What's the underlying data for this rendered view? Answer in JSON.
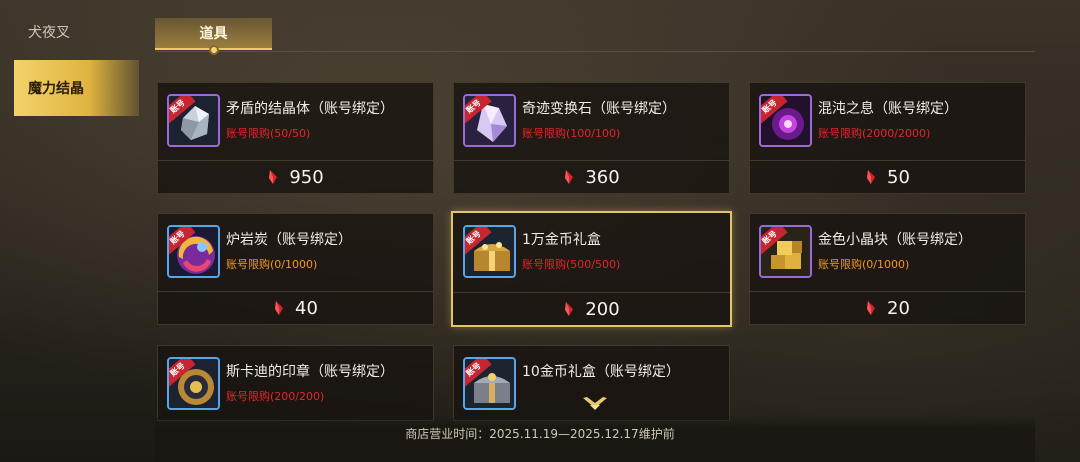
{
  "sidebar": {
    "items": [
      {
        "label": "犬夜叉",
        "selected": false
      },
      {
        "label": "魔力结晶",
        "selected": true
      }
    ]
  },
  "tabs": [
    {
      "label": "道具",
      "selected": true
    }
  ],
  "badge_text": "账号",
  "colors": {
    "accent_gold": "#e2c46a",
    "limit_red": "#e4252c",
    "limit_orange": "#f09a1e",
    "currency_red": "#d8232e"
  },
  "items": [
    {
      "name": "矛盾的结晶体（账号绑定）",
      "limit": "账号限购(50/50)",
      "price": "950",
      "icon": "silver-crystal-icon"
    },
    {
      "name": "奇迹变换石（账号绑定）",
      "limit": "账号限购(100/100)",
      "price": "360",
      "icon": "violet-crystal-icon"
    },
    {
      "name": "混沌之息（账号绑定）",
      "limit": "账号限购(2000/2000)",
      "price": "50",
      "icon": "purple-orb-icon"
    },
    {
      "name": "炉岩炭（账号绑定）",
      "limit": "账号限购(0/1000)",
      "price": "40",
      "icon": "lava-coal-icon"
    },
    {
      "name": "1万金币礼盒",
      "limit": "账号限购(500/500)",
      "price": "200",
      "icon": "gold-chest-icon"
    },
    {
      "name": "金色小晶块（账号绑定）",
      "limit": "账号限购(0/1000)",
      "price": "20",
      "icon": "gold-cubes-icon"
    },
    {
      "name": "斯卡迪的印章（账号绑定）",
      "limit": "账号限购(200/200)",
      "price": "",
      "icon": "seal-medallion-icon"
    },
    {
      "name": "10金币礼盒（账号绑定）",
      "limit": "",
      "price": "",
      "icon": "silver-chest-icon"
    }
  ],
  "footer": {
    "text": "商店营业时间：2025.11.19—2025.12.17维护前"
  }
}
